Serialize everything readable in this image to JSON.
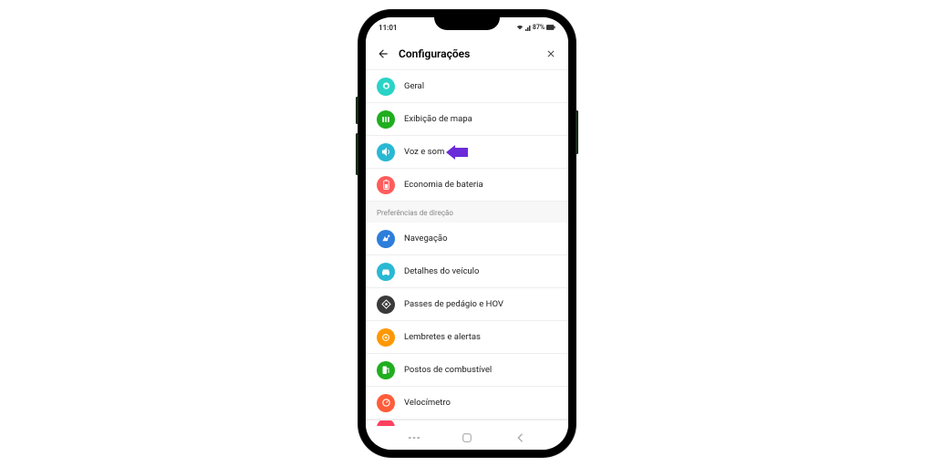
{
  "status": {
    "time": "11:01",
    "battery_pct": "87%"
  },
  "header": {
    "title": "Configurações"
  },
  "section1": {
    "items": [
      {
        "label": "Geral",
        "color": "#29d3c5",
        "icon": "gear"
      },
      {
        "label": "Exibição de mapa",
        "color": "#1fae1f",
        "icon": "map"
      },
      {
        "label": "Voz e som",
        "color": "#29b8d3",
        "icon": "sound",
        "highlighted": true
      },
      {
        "label": "Economia de bateria",
        "color": "#ff5c5c",
        "icon": "battery"
      }
    ]
  },
  "section2": {
    "title": "Preferências de direção",
    "items": [
      {
        "label": "Navegação",
        "color": "#2d7ddb",
        "icon": "nav"
      },
      {
        "label": "Detalhes do veículo",
        "color": "#29b8d3",
        "icon": "car"
      },
      {
        "label": "Passes de pedágio e HOV",
        "color": "#3a3a3a",
        "icon": "toll"
      },
      {
        "label": "Lembretes e alertas",
        "color": "#ff9800",
        "icon": "alert"
      },
      {
        "label": "Postos de combustível",
        "color": "#1fae1f",
        "icon": "fuel"
      },
      {
        "label": "Velocímetro",
        "color": "#ff5c3a",
        "icon": "speed"
      }
    ]
  }
}
